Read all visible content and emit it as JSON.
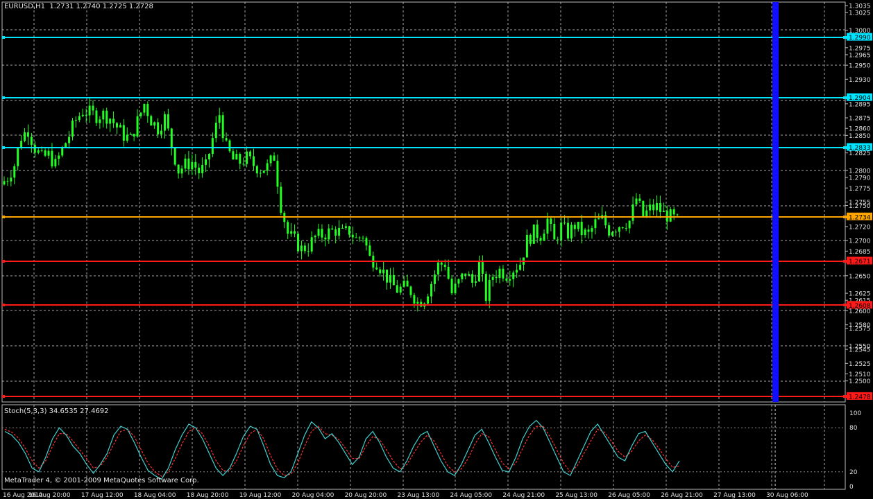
{
  "chart_header": {
    "symbol_timeframe": "EURUSD,H1",
    "ohlc": "1.2731 1.2740 1.2725 1.2728"
  },
  "indicator": {
    "label": "Stoch(5,3,3) 34.6535 27.4692",
    "levels": [
      "100",
      "80",
      "20",
      "0"
    ]
  },
  "copyright": "MetaTrader 4, © 2001-2009 MetaQuotes Software Corp.",
  "colors": {
    "background": "#000000",
    "grid": "#d0d0d0",
    "candles": "#22ff22",
    "resistance": "#00e5ff",
    "current": "#ffa500",
    "support": "#ff1a1a",
    "marker": "#1010ff",
    "stoch_main": "#40d0d0",
    "stoch_signal": "#ff3030"
  },
  "chart_data": {
    "type": "candlestick",
    "symbol": "EURUSD",
    "timeframe": "H1",
    "price_axis_labels": [
      "1.3035",
      "1.3025",
      "1.3000",
      "1.2990",
      "1.2975",
      "1.2965",
      "1.2950",
      "1.2930",
      "1.2904",
      "1.2895",
      "1.2875",
      "1.2860",
      "1.2850",
      "1.2833",
      "1.2825",
      "1.2800",
      "1.2790",
      "1.2775",
      "1.2755",
      "1.2750",
      "1.2734",
      "1.2720",
      "1.2700",
      "1.2685",
      "1.2671",
      "1.2650",
      "1.2625",
      "1.2615",
      "1.2608",
      "1.2600",
      "1.2580",
      "1.2575",
      "1.2550",
      "1.2545",
      "1.2525",
      "1.2510",
      "1.2500",
      "1.2478"
    ],
    "highlighted_price_labels": {
      "cyan": [
        "1.2990",
        "1.2904",
        "1.2833"
      ],
      "orange": [
        "1.2734"
      ],
      "red": [
        "1.2671",
        "1.2608",
        "1.2478"
      ]
    },
    "time_axis_labels": [
      "16 Aug 2010",
      "16 Aug 20:00",
      "17 Aug 12:00",
      "18 Aug 04:00",
      "18 Aug 20:00",
      "19 Aug 12:00",
      "20 Aug 04:00",
      "20 Aug 20:00",
      "23 Aug 13:00",
      "24 Aug 05:00",
      "24 Aug 21:00",
      "25 Aug 13:00",
      "26 Aug 05:00",
      "26 Aug 21:00",
      "27 Aug 13:00",
      "30 Aug 06:00"
    ],
    "horizontal_lines": [
      {
        "price": 1.299,
        "kind": "resistance"
      },
      {
        "price": 1.2904,
        "kind": "resistance"
      },
      {
        "price": 1.2833,
        "kind": "resistance"
      },
      {
        "price": 1.2734,
        "kind": "current"
      },
      {
        "price": 1.2671,
        "kind": "support"
      },
      {
        "price": 1.2608,
        "kind": "support"
      },
      {
        "price": 1.2478,
        "kind": "support"
      }
    ],
    "vertical_marker": {
      "time": "27 Aug 13:00"
    },
    "ylim": [
      1.247,
      1.304
    ],
    "price_path": [
      [
        0,
        1.278
      ],
      [
        2,
        1.279
      ],
      [
        4,
        1.2808
      ],
      [
        6,
        1.2848
      ],
      [
        8,
        1.2858
      ],
      [
        10,
        1.2832
      ],
      [
        12,
        1.2818
      ],
      [
        14,
        1.2822
      ],
      [
        16,
        1.2808
      ],
      [
        18,
        1.283
      ],
      [
        20,
        1.285
      ],
      [
        22,
        1.2872
      ],
      [
        24,
        1.2885
      ],
      [
        26,
        1.2882
      ],
      [
        28,
        1.2878
      ],
      [
        30,
        1.288
      ],
      [
        32,
        1.2875
      ],
      [
        34,
        1.2862
      ],
      [
        36,
        1.285
      ],
      [
        38,
        1.2845
      ],
      [
        40,
        1.287
      ],
      [
        42,
        1.2895
      ],
      [
        44,
        1.2872
      ],
      [
        46,
        1.286
      ],
      [
        48,
        1.2875
      ],
      [
        50,
        1.2835
      ],
      [
        52,
        1.28
      ],
      [
        54,
        1.2808
      ],
      [
        56,
        1.2812
      ],
      [
        58,
        1.2798
      ],
      [
        60,
        1.2805
      ],
      [
        62,
        1.2845
      ],
      [
        64,
        1.288
      ],
      [
        66,
        1.2832
      ],
      [
        68,
        1.2815
      ],
      [
        70,
        1.2812
      ],
      [
        72,
        1.2818
      ],
      [
        74,
        1.2808
      ],
      [
        76,
        1.2802
      ],
      [
        78,
        1.2805
      ],
      [
        80,
        1.282
      ],
      [
        82,
        1.275
      ],
      [
        84,
        1.271
      ],
      [
        86,
        1.27
      ],
      [
        88,
        1.2688
      ],
      [
        90,
        1.2692
      ],
      [
        92,
        1.2705
      ],
      [
        94,
        1.2708
      ],
      [
        96,
        1.2712
      ],
      [
        98,
        1.2715
      ],
      [
        100,
        1.271
      ],
      [
        102,
        1.2714
      ],
      [
        104,
        1.2702
      ],
      [
        106,
        1.2708
      ],
      [
        108,
        1.2675
      ],
      [
        110,
        1.267
      ],
      [
        112,
        1.2655
      ],
      [
        114,
        1.264
      ],
      [
        116,
        1.263
      ],
      [
        118,
        1.2633
      ],
      [
        120,
        1.2628
      ],
      [
        122,
        1.2612
      ],
      [
        124,
        1.2618
      ],
      [
        126,
        1.264
      ],
      [
        128,
        1.2665
      ],
      [
        130,
        1.2668
      ],
      [
        132,
        1.2625
      ],
      [
        134,
        1.264
      ],
      [
        136,
        1.2655
      ],
      [
        138,
        1.264
      ],
      [
        140,
        1.2665
      ],
      [
        142,
        1.262
      ],
      [
        144,
        1.265
      ],
      [
        146,
        1.2658
      ],
      [
        148,
        1.2652
      ],
      [
        150,
        1.266
      ],
      [
        152,
        1.2668
      ],
      [
        154,
        1.27
      ],
      [
        156,
        1.2712
      ],
      [
        158,
        1.2708
      ],
      [
        160,
        1.273
      ],
      [
        162,
        1.2698
      ],
      [
        164,
        1.272
      ],
      [
        166,
        1.271
      ],
      [
        168,
        1.2722
      ],
      [
        170,
        1.2712
      ],
      [
        172,
        1.2708
      ],
      [
        174,
        1.2725
      ],
      [
        176,
        1.273
      ],
      [
        178,
        1.2715
      ],
      [
        180,
        1.272
      ],
      [
        182,
        1.2725
      ],
      [
        184,
        1.2728
      ],
      [
        186,
        1.276
      ],
      [
        188,
        1.2735
      ],
      [
        190,
        1.2745
      ],
      [
        192,
        1.2748
      ],
      [
        194,
        1.2738
      ],
      [
        196,
        1.2734
      ],
      [
        198,
        1.2728
      ]
    ],
    "stochastic": {
      "main": [
        75,
        70,
        60,
        45,
        25,
        20,
        40,
        65,
        80,
        70,
        55,
        45,
        30,
        18,
        30,
        45,
        70,
        82,
        78,
        60,
        40,
        22,
        15,
        10,
        25,
        50,
        70,
        85,
        80,
        65,
        45,
        25,
        15,
        25,
        45,
        68,
        82,
        78,
        55,
        30,
        15,
        12,
        20,
        45,
        70,
        88,
        80,
        65,
        72,
        60,
        45,
        30,
        40,
        65,
        75,
        60,
        40,
        25,
        20,
        35,
        55,
        70,
        75,
        55,
        35,
        20,
        15,
        30,
        50,
        70,
        78,
        60,
        40,
        22,
        20,
        40,
        65,
        82,
        90,
        80,
        60,
        40,
        20,
        15,
        35,
        55,
        75,
        85,
        70,
        55,
        40,
        35,
        55,
        72,
        75,
        60,
        45,
        30,
        20,
        35
      ],
      "signal": [
        78,
        74,
        66,
        52,
        35,
        25,
        35,
        55,
        72,
        72,
        62,
        50,
        38,
        25,
        28,
        40,
        58,
        75,
        78,
        68,
        50,
        32,
        20,
        14,
        20,
        38,
        58,
        75,
        80,
        72,
        55,
        35,
        22,
        22,
        35,
        55,
        72,
        78,
        65,
        42,
        24,
        15,
        17,
        32,
        55,
        75,
        82,
        72,
        70,
        64,
        52,
        38,
        38,
        55,
        68,
        64,
        50,
        35,
        24,
        30,
        45,
        60,
        70,
        62,
        45,
        28,
        20,
        24,
        38,
        58,
        72,
        68,
        50,
        32,
        24,
        32,
        52,
        70,
        82,
        82,
        68,
        50,
        32,
        20,
        28,
        45,
        62,
        78,
        74,
        62,
        48,
        40,
        48,
        62,
        70,
        64,
        52,
        38,
        26,
        28
      ]
    }
  }
}
